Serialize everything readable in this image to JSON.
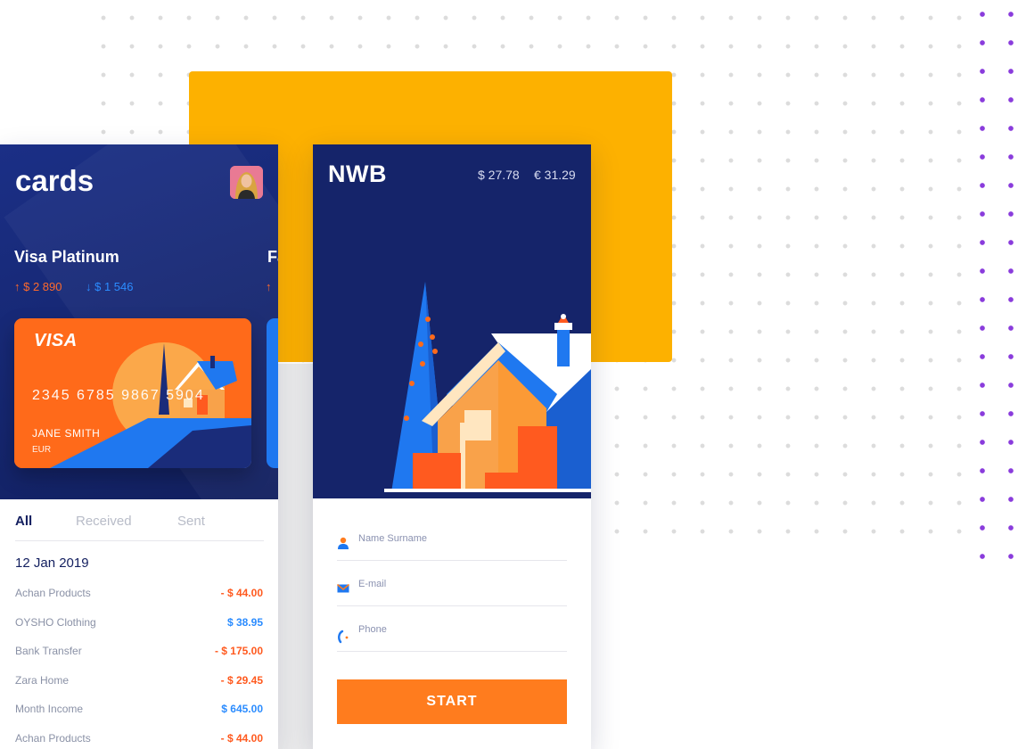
{
  "left_phone": {
    "title": "cards",
    "card_name": "Visa Platinum",
    "card_name_next": "Fa",
    "amount_in": "↑ $ 2 890",
    "amount_out": "↓ $ 1 546",
    "amount_in_next": "↑",
    "card": {
      "brand": "VISA",
      "number": "2345 6785 9867 5904",
      "holder": "JANE SMITH",
      "currency": "EUR"
    },
    "tabs": [
      "All",
      "Received",
      "Sent"
    ],
    "date": "12 Jan 2019",
    "transactions": [
      {
        "name": "Achan Products",
        "amount": "- $ 44.00"
      },
      {
        "name": "OYSHO Clothing",
        "amount": "$ 38.95"
      },
      {
        "name": "Bank Transfer",
        "amount": "- $ 175.00"
      },
      {
        "name": "Zara Home",
        "amount": "- $ 29.45"
      },
      {
        "name": "Month Income",
        "amount": "$ 645.00"
      },
      {
        "name": "Achan Products",
        "amount": "- $ 44.00"
      }
    ]
  },
  "right_phone": {
    "brand": "NWB",
    "balance_usd": "$ 27.78",
    "balance_eur": "€ 31.29",
    "fields": {
      "name_placeholder": "Name Surname",
      "email_placeholder": "E-mail",
      "phone_placeholder": "Phone"
    },
    "start_label": "START"
  },
  "colors": {
    "navy": "#15246A",
    "orange": "#FF7C1E",
    "yellow": "#FDB100",
    "blue": "#2B8CFF",
    "purple": "#8A3CDC"
  },
  "icons": [
    "user-icon",
    "mail-icon",
    "phone-icon"
  ]
}
